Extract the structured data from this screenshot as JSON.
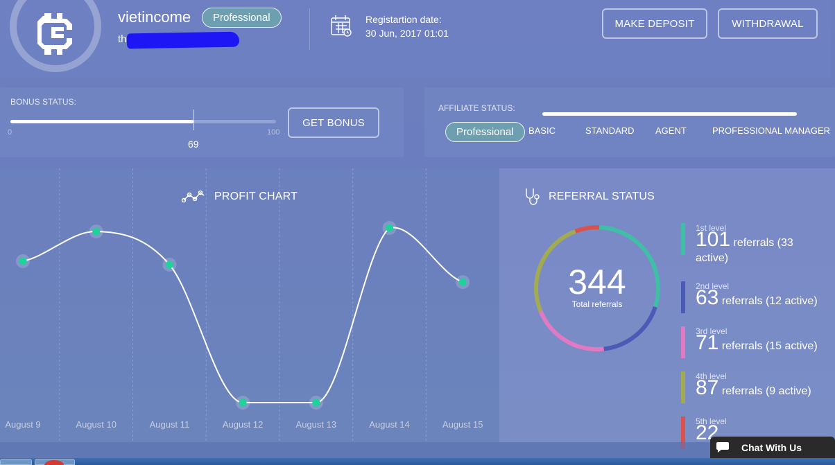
{
  "profile": {
    "username": "vietincome",
    "status_badge": "Professional",
    "email_visible_start": "th"
  },
  "registration": {
    "label": "Registartion date:",
    "date": "30 Jun, 2017 01:01"
  },
  "actions": {
    "deposit_label": "MAKE DEPOSIT",
    "withdraw_label": "WITHDRAWAL"
  },
  "bonus": {
    "label": "BONUS STATUS:",
    "min": "0",
    "max": "100",
    "value": "69",
    "fill_fraction": 0.69,
    "button_label": "GET BONUS"
  },
  "affiliate": {
    "label": "AFFILIATE STATUS:",
    "current": "Professional",
    "levels": [
      "BASIC",
      "STANDARD",
      "AGENT",
      "PROFESSIONAL MANAGER"
    ]
  },
  "profit_chart": {
    "title": "PROFIT CHART",
    "icon": "line-chart-icon"
  },
  "chart_data": {
    "type": "line",
    "title": "PROFIT CHART",
    "categories": [
      "August 9",
      "August 10",
      "August 11",
      "August 12",
      "August 13",
      "August 14",
      "August 15"
    ],
    "values": [
      0.81,
      0.98,
      0.79,
      0.0,
      0.0,
      1.0,
      0.69
    ],
    "xlabel": "",
    "ylabel": "",
    "ylim": [
      0,
      1
    ],
    "grid": true,
    "line_color": "#ffffff",
    "point_color": "#1fd19a"
  },
  "referral": {
    "title": "REFERRAL STATUS",
    "total": "344",
    "total_label": "Total referrals",
    "levels": [
      {
        "name": "1st level",
        "count": "101",
        "text": "referrals (33 active)",
        "color": "#3fbfa6",
        "share": 101
      },
      {
        "name": "2nd level",
        "count": "63",
        "text": "referrals (12 active)",
        "color": "#4b5bb5",
        "share": 63
      },
      {
        "name": "3rd level",
        "count": "71",
        "text": "referrals (15 active)",
        "color": "#e17ac3",
        "share": 71
      },
      {
        "name": "4th level",
        "count": "87",
        "text": "referrals (9 active)",
        "color": "#a3ab52",
        "share": 87
      },
      {
        "name": "5th level",
        "count": "22",
        "text": "",
        "color": "#d9524e",
        "share": 22
      }
    ]
  },
  "chat": {
    "label": "Chat With Us"
  },
  "colors": {
    "badge": "#6d9fb0",
    "redaction": "#1f16f5"
  }
}
